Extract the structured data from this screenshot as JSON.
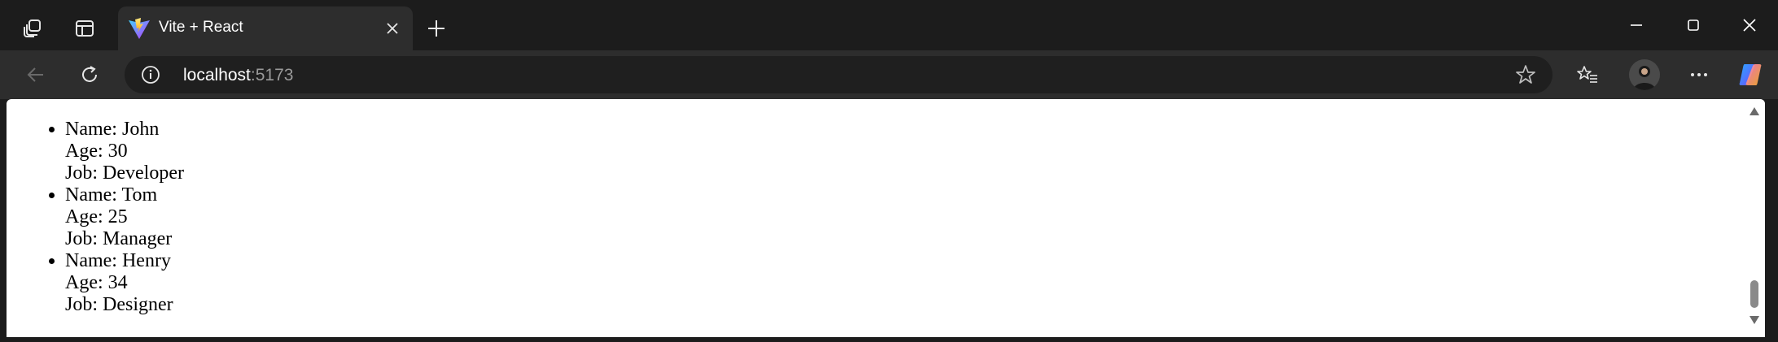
{
  "browser": {
    "tab": {
      "title": "Vite + React"
    },
    "address": {
      "host": "localhost",
      "port": ":5173"
    }
  },
  "icons": {
    "workspaces": "workspaces-icon",
    "tab_actions": "tab-actions-icon",
    "favicon": "vite-logo-icon",
    "close": "close-icon",
    "new_tab": "plus-icon",
    "minimize": "minimize-icon",
    "maximize": "maximize-icon",
    "window_close": "window-close-icon",
    "back": "back-arrow-icon",
    "refresh": "refresh-icon",
    "info": "info-icon",
    "favorite": "star-icon",
    "favorites": "favorites-list-icon",
    "menu": "more-dots-icon",
    "copilot": "copilot-icon"
  },
  "people": [
    {
      "name": "Name: John",
      "age": "Age: 30",
      "job": "Job: Developer"
    },
    {
      "name": "Name: Tom",
      "age": "Age: 25",
      "job": "Job: Manager"
    },
    {
      "name": "Name: Henry",
      "age": "Age: 34",
      "job": "Job: Designer"
    }
  ]
}
